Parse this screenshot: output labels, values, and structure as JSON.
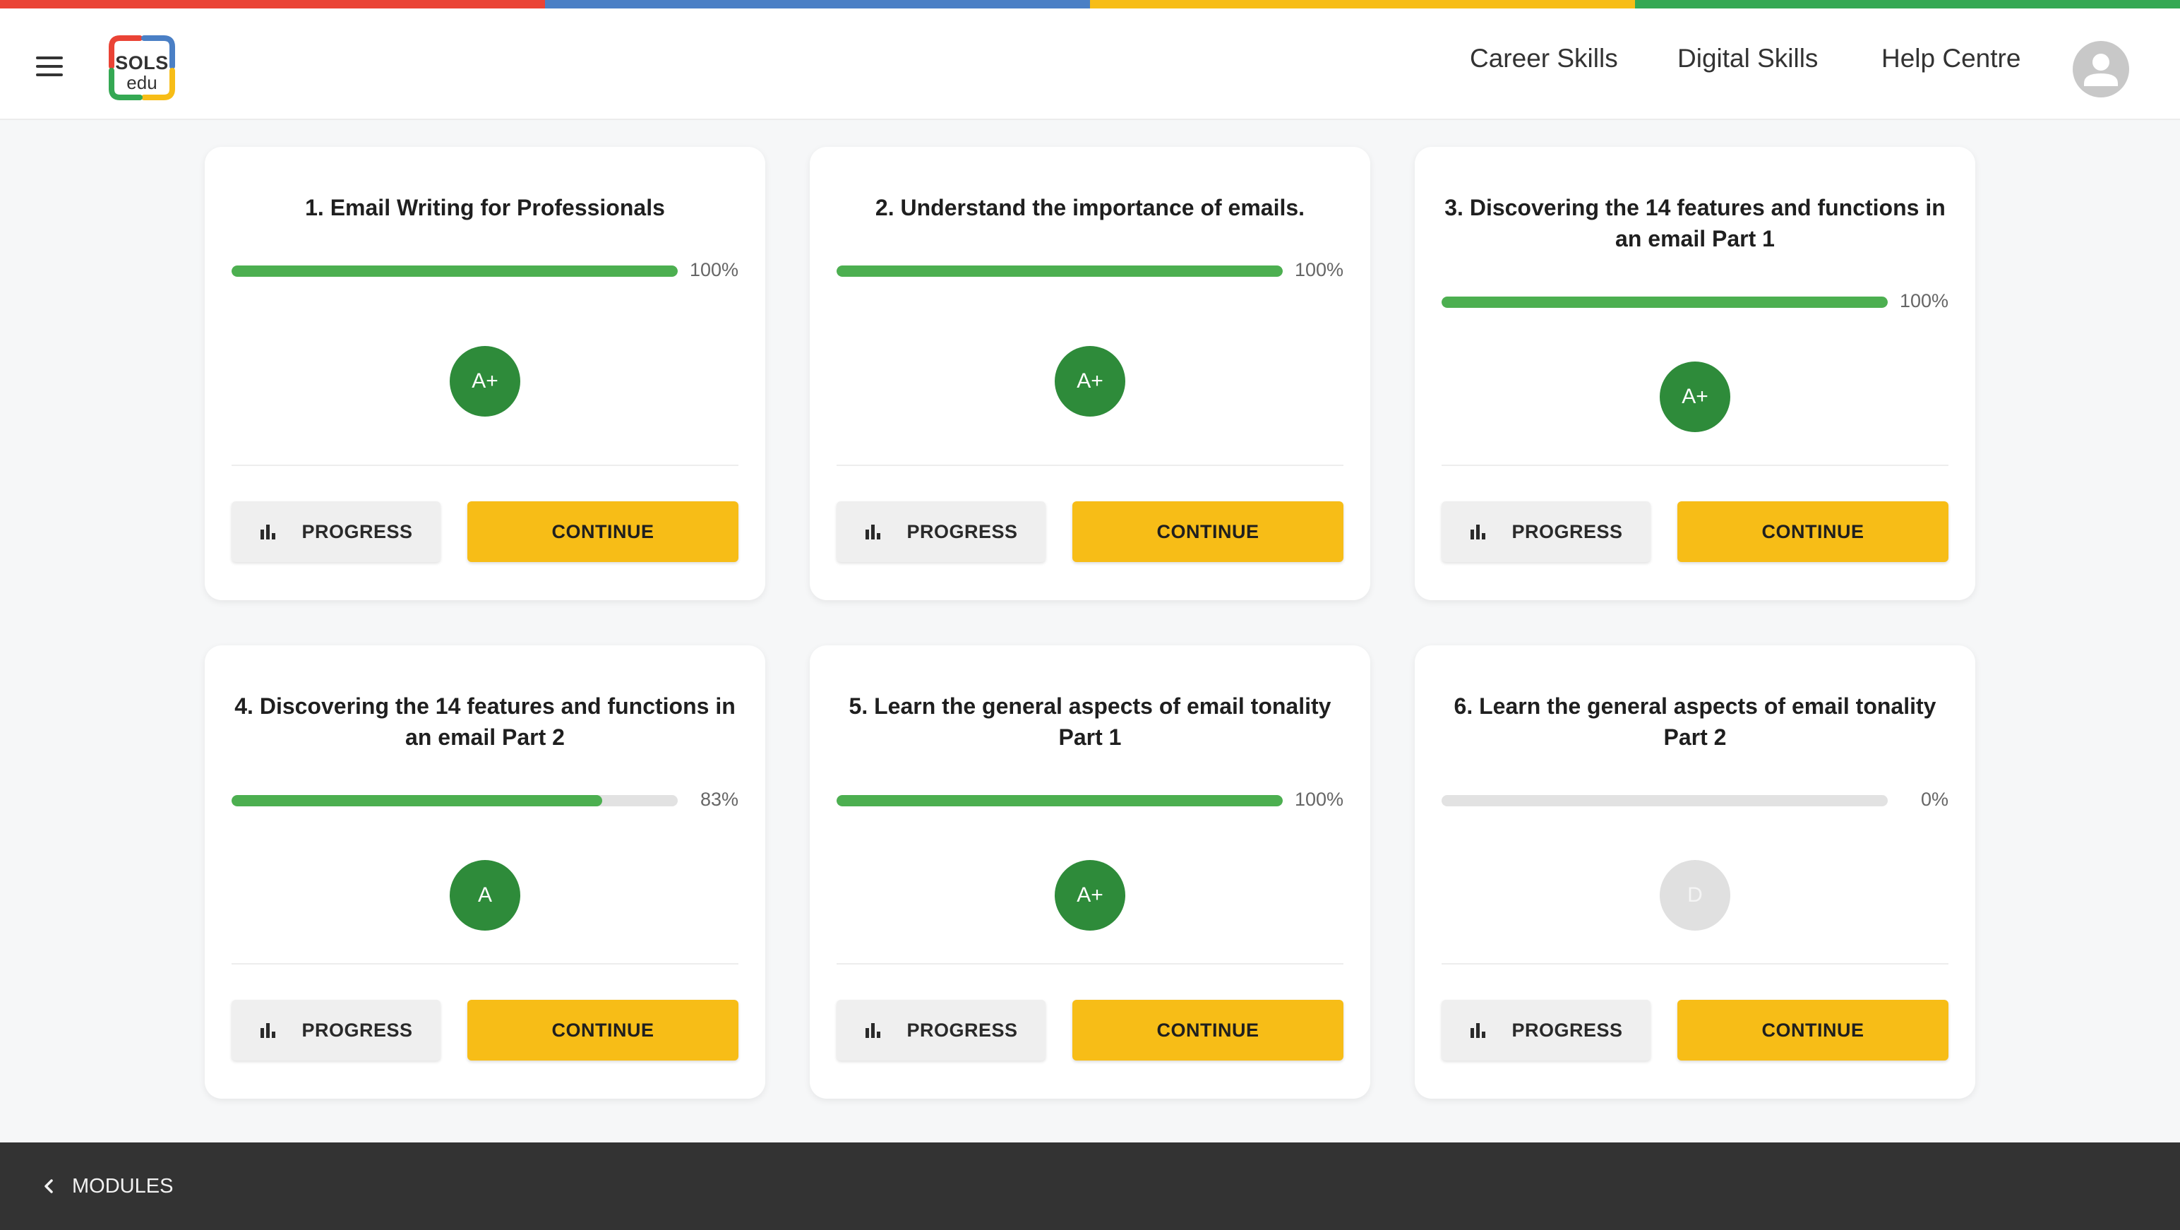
{
  "colors": {
    "stripe": [
      "#ea4335",
      "#4a7fc5",
      "#f7bd17",
      "#34a853"
    ],
    "progress_fill": "#4caf50",
    "grade_bg": "#2e8b3a",
    "continue_bg": "#f7bd17",
    "footer_bg": "#333333"
  },
  "header": {
    "menu_icon": "hamburger-menu-icon",
    "logo": {
      "line1": "SOLS",
      "line2": "edu"
    },
    "nav": [
      "Career Skills",
      "Digital Skills",
      "Help Centre"
    ],
    "avatar_icon": "user-avatar-icon"
  },
  "cards": [
    {
      "title": "1. Email Writing for Professionals",
      "progress": 100,
      "progress_label": "100%",
      "grade": "A+",
      "progress_button": "PROGRESS",
      "continue_button": "CONTINUE"
    },
    {
      "title": "2. Understand the importance of emails.",
      "progress": 100,
      "progress_label": "100%",
      "grade": "A+",
      "progress_button": "PROGRESS",
      "continue_button": "CONTINUE"
    },
    {
      "title": "3. Discovering the 14 features and functions in an email Part 1",
      "progress": 100,
      "progress_label": "100%",
      "grade": "A+",
      "progress_button": "PROGRESS",
      "continue_button": "CONTINUE"
    },
    {
      "title": "4. Discovering the 14 features and functions in an email Part 2",
      "progress": 83,
      "progress_label": "83%",
      "grade": "A",
      "progress_button": "PROGRESS",
      "continue_button": "CONTINUE"
    },
    {
      "title": "5. Learn the general aspects of email tonality Part 1",
      "progress": 100,
      "progress_label": "100%",
      "grade": "A+",
      "progress_button": "PROGRESS",
      "continue_button": "CONTINUE"
    },
    {
      "title": "6. Learn the general aspects of email tonality Part 2",
      "progress": 0,
      "progress_label": "0%",
      "grade": "D",
      "grade_empty": true,
      "progress_button": "PROGRESS",
      "continue_button": "CONTINUE"
    }
  ],
  "footer": {
    "back_icon": "chevron-left-icon",
    "modules_label": "MODULES"
  }
}
